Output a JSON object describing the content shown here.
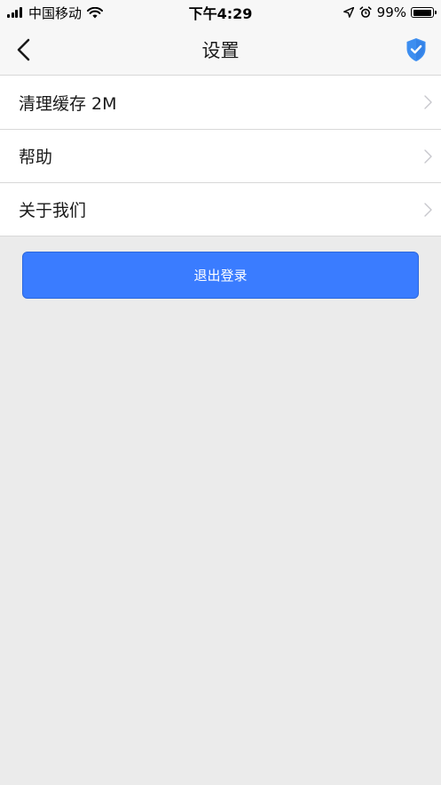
{
  "status_bar": {
    "carrier": "中国移动",
    "time": "下午4:29",
    "battery_percent": "99%",
    "battery_level": 0.99,
    "icons": [
      "signal-bars-icon",
      "wifi-icon",
      "location-arrow-icon",
      "alarm-clock-icon",
      "battery-icon"
    ]
  },
  "nav": {
    "title": "设置",
    "back_icon": "chevron-left-icon",
    "right_icon": "shield-check-icon"
  },
  "settings": {
    "items": [
      {
        "label": "清理缓存 2M"
      },
      {
        "label": "帮助"
      },
      {
        "label": "关于我们"
      }
    ]
  },
  "logout": {
    "label": "退出登录"
  },
  "colors": {
    "accent": "#3a7cff",
    "shield": "#3d8ef0",
    "background": "#ebebeb",
    "nav_background": "#f7f7f7",
    "divider": "#d8d8d8",
    "chevron": "#c7c7cc"
  }
}
